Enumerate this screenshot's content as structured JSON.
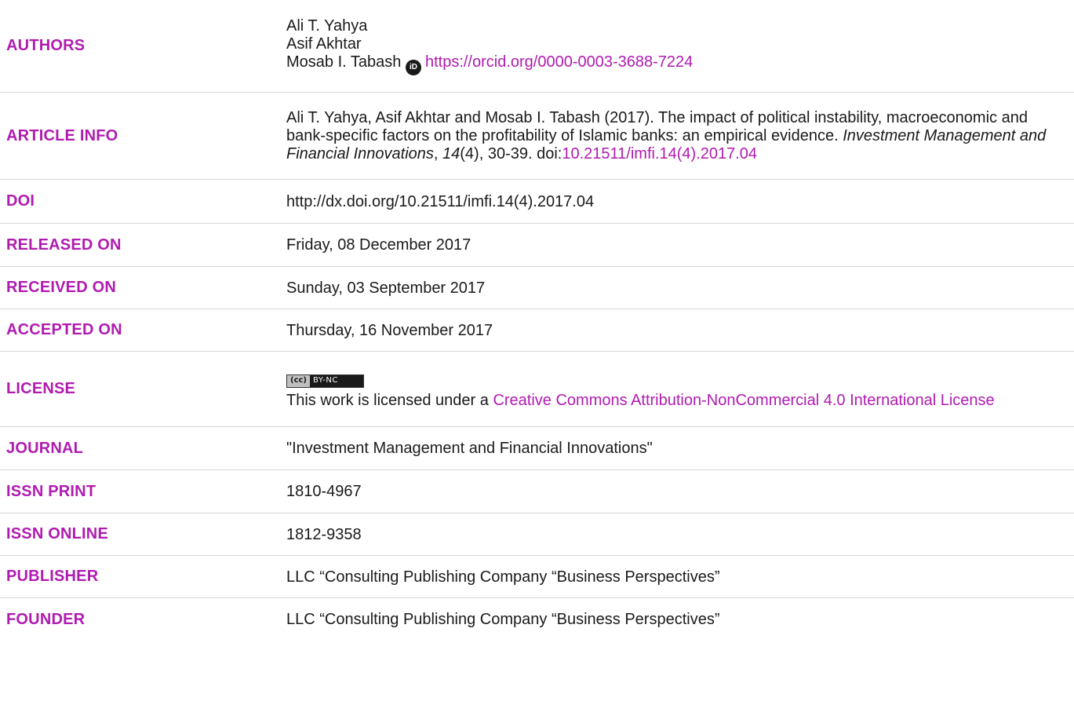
{
  "rows": {
    "authors": {
      "label": "AUTHORS",
      "names": [
        "Ali T. Yahya",
        "Asif Akhtar",
        "Mosab I. Tabash"
      ],
      "orcid_icon": "iD",
      "orcid_link": "https://orcid.org/0000-0003-3688-7224"
    },
    "article_info": {
      "label": "ARTICLE INFO",
      "citation_part1": "Ali T. Yahya, Asif Akhtar and Mosab I. Tabash (2017). The impact of political instability, macroeconomic and bank-specific factors on the profitability of Islamic banks: an empirical evidence. ",
      "journal_italic": "Investment Management and Financial Innovations",
      "sep1": ", ",
      "volume_italic": "14",
      "rest": "(4), 30-39. doi:",
      "doi_link": "10.21511/imfi.14(4).2017.04"
    },
    "doi": {
      "label": "DOI",
      "value": "http://dx.doi.org/10.21511/imfi.14(4).2017.04"
    },
    "released_on": {
      "label": "RELEASED ON",
      "value": "Friday, 08 December 2017"
    },
    "received_on": {
      "label": "RECEIVED ON",
      "value": "Sunday, 03 September 2017"
    },
    "accepted_on": {
      "label": "ACCEPTED ON",
      "value": "Thursday, 16 November 2017"
    },
    "license": {
      "label": "LICENSE",
      "badge_cc": "(cc)",
      "badge_text": "BY-NC",
      "text": "This work is licensed under a ",
      "link": "Creative Commons Attribution-NonCommercial 4.0 International License"
    },
    "journal": {
      "label": "JOURNAL",
      "value": "\"Investment Management and Financial Innovations\""
    },
    "issn_print": {
      "label": "ISSN PRINT",
      "value": "1810-4967"
    },
    "issn_online": {
      "label": "ISSN ONLINE",
      "value": "1812-9358"
    },
    "publisher": {
      "label": "PUBLISHER",
      "value": "LLC “Consulting Publishing Company “Business Perspectives”"
    },
    "founder": {
      "label": "FOUNDER",
      "value": "LLC “Consulting Publishing Company “Business Perspectives”"
    }
  },
  "colors": {
    "accent": "#b01bb0",
    "text": "#1a1a1a",
    "divider": "#d6d6d6"
  }
}
